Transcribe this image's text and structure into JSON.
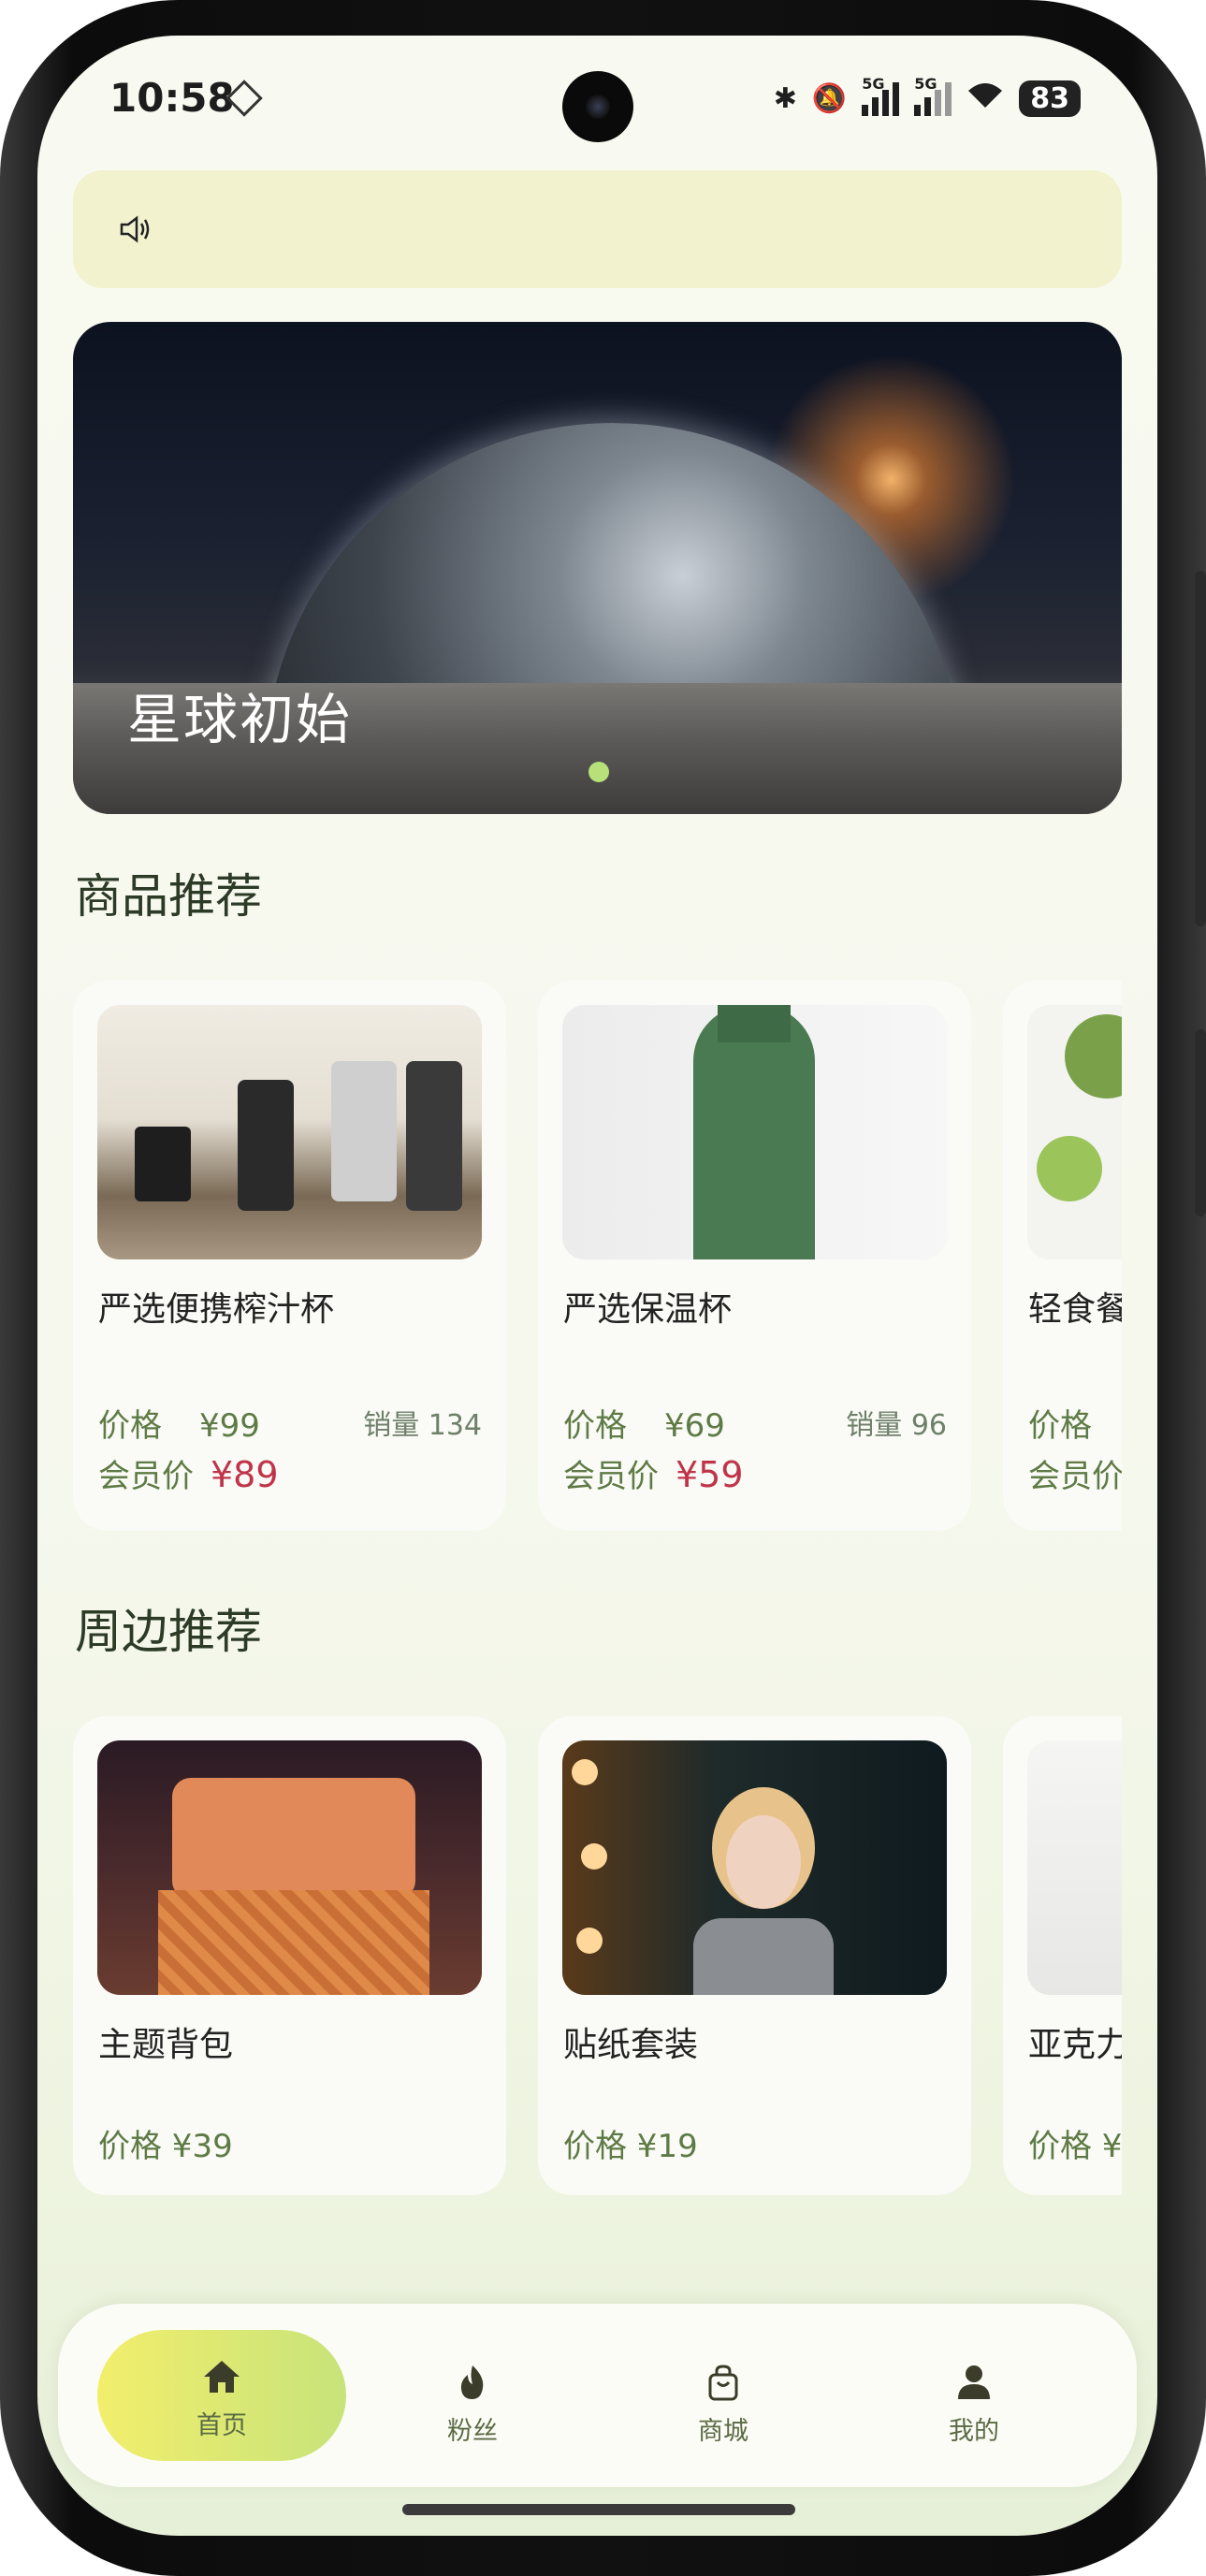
{
  "status_bar": {
    "time": "10:58",
    "battery": "83",
    "network_1": "5G",
    "network_2": "5G"
  },
  "banner": {
    "title": "星球初始"
  },
  "section_products": {
    "title": "商品推荐",
    "items": [
      {
        "name": "严选便携榨汁杯",
        "price_label": "价格",
        "price": "¥99",
        "sales": "销量 134",
        "member_label": "会员价",
        "member_price": "¥89"
      },
      {
        "name": "严选保温杯",
        "price_label": "价格",
        "price": "¥69",
        "sales": "销量 96",
        "member_label": "会员价",
        "member_price": "¥59"
      },
      {
        "name": "轻食餐",
        "price_label": "价格",
        "member_label": "会员价"
      }
    ]
  },
  "section_peripherals": {
    "title": "周边推荐",
    "items": [
      {
        "name": "主题背包",
        "price_text": "价格 ¥39"
      },
      {
        "name": "贴纸套装",
        "price_text": "价格 ¥19"
      },
      {
        "name": "亚克力",
        "price_text": "价格 ¥"
      }
    ]
  },
  "nav": {
    "items": [
      {
        "label": "首页",
        "icon": "home-icon",
        "active": true
      },
      {
        "label": "粉丝",
        "icon": "flame-icon"
      },
      {
        "label": "商城",
        "icon": "shopping-bag-icon"
      },
      {
        "label": "我的",
        "icon": "user-icon"
      }
    ]
  },
  "colors": {
    "accent_green": "#5e7b45",
    "member_price_red": "#c0344a",
    "nav_active_start": "#f2ee6c",
    "nav_active_end": "#c7e37a",
    "notice_bg": "#f2f2cf"
  }
}
